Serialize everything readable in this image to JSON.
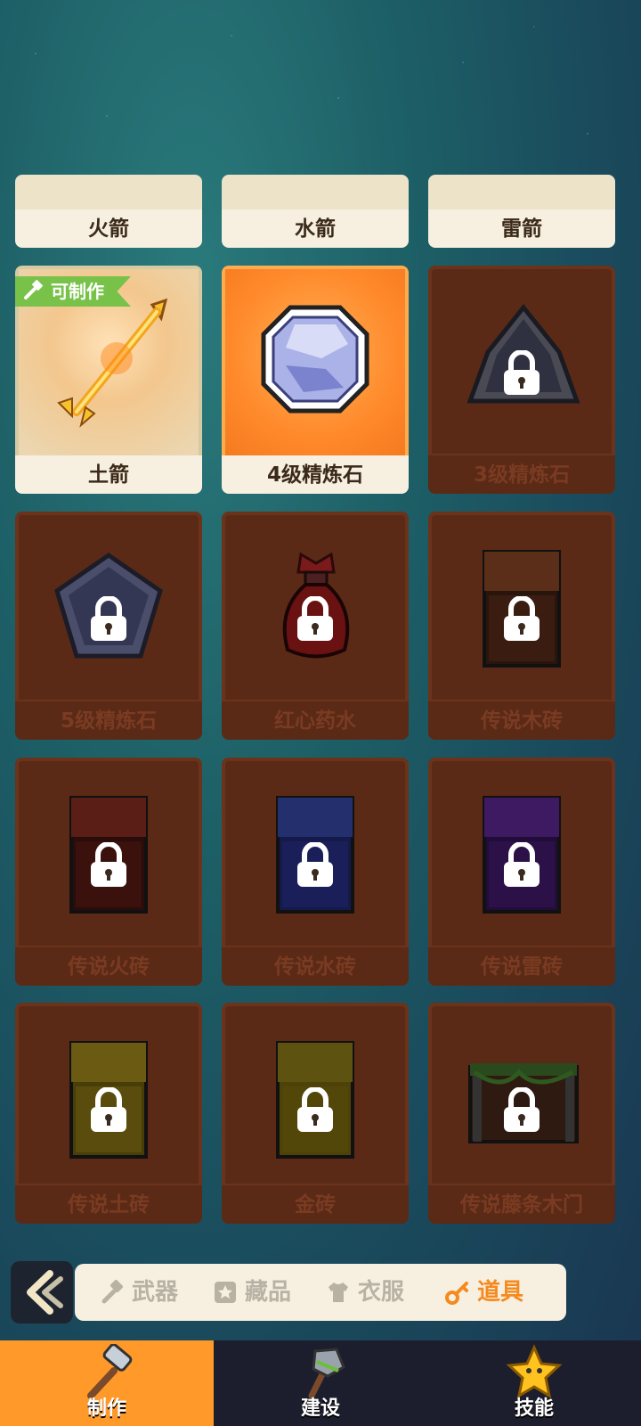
{
  "row_top": [
    {
      "name": "火箭"
    },
    {
      "name": "水箭"
    },
    {
      "name": "雷箭"
    }
  ],
  "items": [
    {
      "name": "土箭",
      "state": "craftable",
      "badge": "可制作",
      "icon": "golden-arrow-icon"
    },
    {
      "name": "4级精炼石",
      "state": "selected",
      "icon": "refining-stone-icon"
    },
    {
      "name": "3级精炼石",
      "state": "locked",
      "icon": "dark-stone-icon"
    },
    {
      "name": "5级精炼石",
      "state": "locked",
      "icon": "pentagon-stone-icon"
    },
    {
      "name": "红心药水",
      "state": "locked",
      "icon": "red-potion-icon"
    },
    {
      "name": "传说木砖",
      "state": "locked",
      "icon": "wood-brick-icon"
    },
    {
      "name": "传说火砖",
      "state": "locked",
      "icon": "fire-brick-icon"
    },
    {
      "name": "传说水砖",
      "state": "locked",
      "icon": "water-brick-icon"
    },
    {
      "name": "传说雷砖",
      "state": "locked",
      "icon": "thunder-brick-icon"
    },
    {
      "name": "传说土砖",
      "state": "locked",
      "icon": "earth-brick-icon"
    },
    {
      "name": "金砖",
      "state": "locked",
      "icon": "gold-brick-icon"
    },
    {
      "name": "传说藤条木门",
      "state": "locked",
      "icon": "vine-door-icon"
    }
  ],
  "category_tabs": [
    {
      "label": "武器",
      "icon": "hammer-icon",
      "active": false
    },
    {
      "label": "藏品",
      "icon": "star-icon",
      "active": false
    },
    {
      "label": "衣服",
      "icon": "shirt-icon",
      "active": false
    },
    {
      "label": "道具",
      "icon": "key-icon",
      "active": true
    }
  ],
  "bottom_nav": [
    {
      "label": "制作",
      "icon": "hammer-icon",
      "active": true
    },
    {
      "label": "建设",
      "icon": "stone-hammer-icon",
      "active": false
    },
    {
      "label": "技能",
      "icon": "star-icon",
      "active": false
    }
  ],
  "colors": {
    "accent": "#ff9a2a",
    "locked": "#5a2a16",
    "badge": "#78c24a"
  }
}
